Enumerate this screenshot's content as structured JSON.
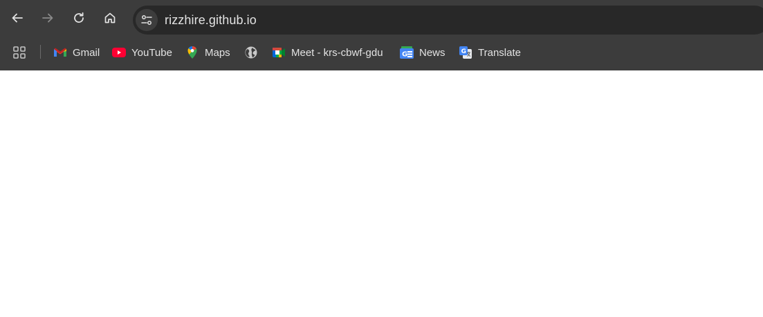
{
  "browser": {
    "url": "rizzhire.github.io",
    "nav": {
      "back": "back-arrow",
      "forward": "forward-arrow",
      "reload": "reload",
      "home": "home"
    }
  },
  "bookmarks": [
    {
      "label": "Gmail",
      "icon": "gmail-icon"
    },
    {
      "label": "YouTube",
      "icon": "youtube-icon"
    },
    {
      "label": "Maps",
      "icon": "maps-icon"
    },
    {
      "label": "",
      "icon": "globe-icon"
    },
    {
      "label": "Meet - krs-cbwf-gdu",
      "icon": "meet-icon"
    },
    {
      "label": "News",
      "icon": "news-icon"
    },
    {
      "label": "Translate",
      "icon": "translate-icon"
    }
  ],
  "colors": {
    "chrome_bg": "#3c3c3c",
    "omnibox_bg": "#282828",
    "text": "#e3e3e3"
  }
}
